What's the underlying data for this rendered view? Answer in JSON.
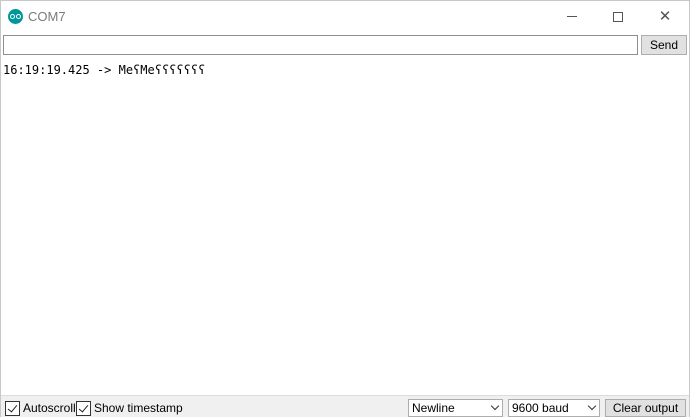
{
  "window": {
    "title": "COM7",
    "minimize_glyph": "",
    "close_glyph": "✕"
  },
  "send_bar": {
    "input_value": "",
    "send_label": "Send"
  },
  "output": {
    "lines": [
      "16:19:19.425 -> MeʕMeʕʕʕʕʕʕʕ"
    ]
  },
  "bottom_bar": {
    "autoscroll_label": "Autoscroll",
    "autoscroll_checked": true,
    "timestamp_label": "Show timestamp",
    "timestamp_checked": true,
    "line_ending_value": "Newline",
    "baud_value": "9600 baud",
    "clear_label": "Clear output"
  },
  "colors": {
    "brand": "#00979c",
    "button_bg": "#e1e1e1",
    "bar_bg": "#f0f0f0"
  }
}
